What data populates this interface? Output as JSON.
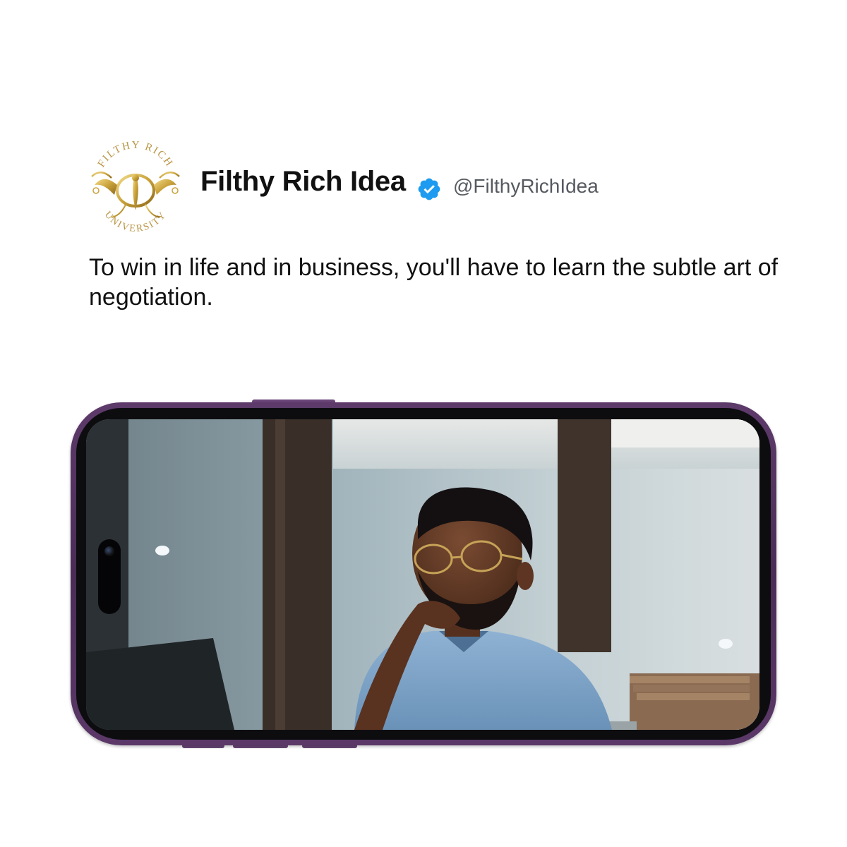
{
  "post": {
    "logo": {
      "top_text": "FILTHY RICH",
      "bottom_text": "UNIVERSITY",
      "icon": "phoenix-emblem-icon",
      "color": "#c9a23a"
    },
    "author_name": "Filthy Rich Idea",
    "verified_icon": "verified-badge-icon",
    "verified_color": "#1d9bf0",
    "handle": "@FilthyRichIdea",
    "text": "To win in life and in business, you'll have to learn the subtle art of negotiation."
  },
  "phone": {
    "frame_color": "#5a3766",
    "screen_image": "man-with-glasses-thinking-in-office-photo",
    "camera_icon": "front-camera-icon"
  }
}
